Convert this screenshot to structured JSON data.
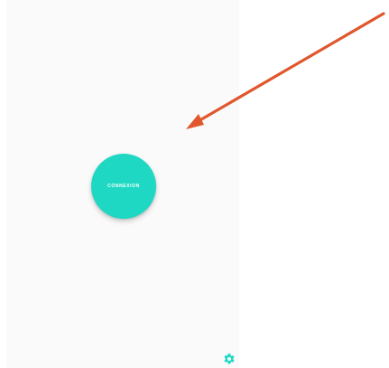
{
  "main": {
    "connect_label": "CONNEXION"
  },
  "icons": {
    "settings": "gear-icon",
    "annotation": "arrow-icon"
  },
  "colors": {
    "accent": "#1ed8c3",
    "background": "#fafafa",
    "annotation": "#e0572d"
  }
}
